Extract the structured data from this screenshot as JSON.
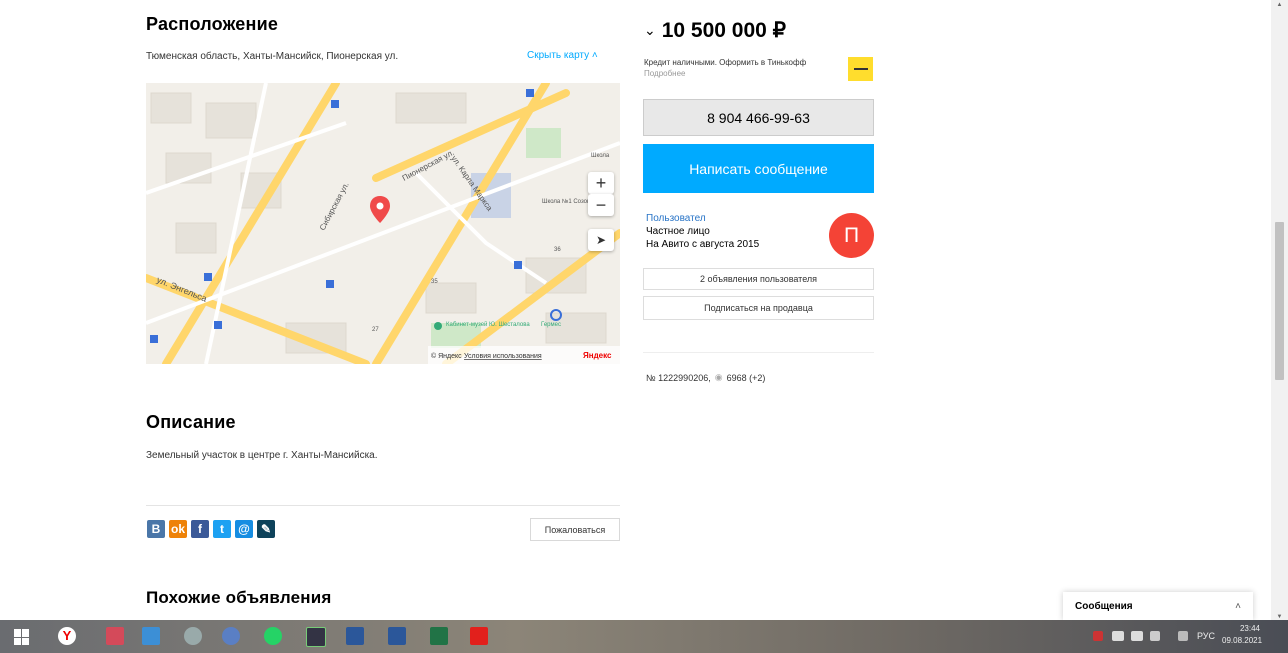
{
  "location": {
    "title": "Расположение",
    "address": "Тюменская область, Ханты-Мансийск, Пионерская ул.",
    "hide_map": "Скрыть карту",
    "map": {
      "labels": {
        "pionerskaya": "Пионерская ул.",
        "engelsa": "ул. Энгельса",
        "karla_marksa": "ул. Карла Маркса",
        "sibirskaya": "Сибирская ул.",
        "school": "Школа №1 Созонова",
        "school2": "Школа",
        "museum": "Кабинет-музей Ю. Шесталова",
        "germes": "Гермес",
        "house_35": "35",
        "house_36": "36",
        "house_27": "27"
      },
      "copyright": "© Яндекс",
      "terms": "Условия использования",
      "brand": "Яндекс",
      "zoom_in": "+",
      "zoom_out": "−"
    }
  },
  "description": {
    "title": "Описание",
    "text": "Земельный участок в центре г. Ханты-Мансийска."
  },
  "share": {
    "icons": [
      {
        "name": "vk-icon",
        "glyph": "В",
        "color": "#4a76a8"
      },
      {
        "name": "ok-icon",
        "glyph": "ok",
        "color": "#ee8208"
      },
      {
        "name": "facebook-icon",
        "glyph": "f",
        "color": "#3b5998"
      },
      {
        "name": "twitter-icon",
        "glyph": "t",
        "color": "#1da1f2"
      },
      {
        "name": "mail-icon",
        "glyph": "@",
        "color": "#168de2"
      },
      {
        "name": "livejournal-icon",
        "glyph": "✎",
        "color": "#0d425a"
      }
    ],
    "complain": "Пожаловаться"
  },
  "similar": {
    "title": "Похожие объявления"
  },
  "sidebar": {
    "price": "10 500 000 ₽",
    "credit_text": "Кредит наличными. Оформить в Тинькофф",
    "credit_more": "Подробнее",
    "phone": "8 904 466-99-63",
    "write": "Написать сообщение",
    "user_name": "Пользовател",
    "user_type": "Частное лицо",
    "user_since": "На Авито с августа 2015",
    "avatar_letter": "П",
    "ads_button": "2 объявления пользователя",
    "subscribe": "Подписаться на продавца",
    "ad_number": "№ 1222990206,",
    "views": "6968 (+2)"
  },
  "messages_panel": {
    "label": "Сообщения"
  },
  "taskbar": {
    "lang": "РУС",
    "time": "23:44",
    "date": "09.08.2021"
  },
  "colors": {
    "accent": "#00aaff",
    "avatar": "#f44336",
    "phone_bg": "#e8e8e8"
  }
}
